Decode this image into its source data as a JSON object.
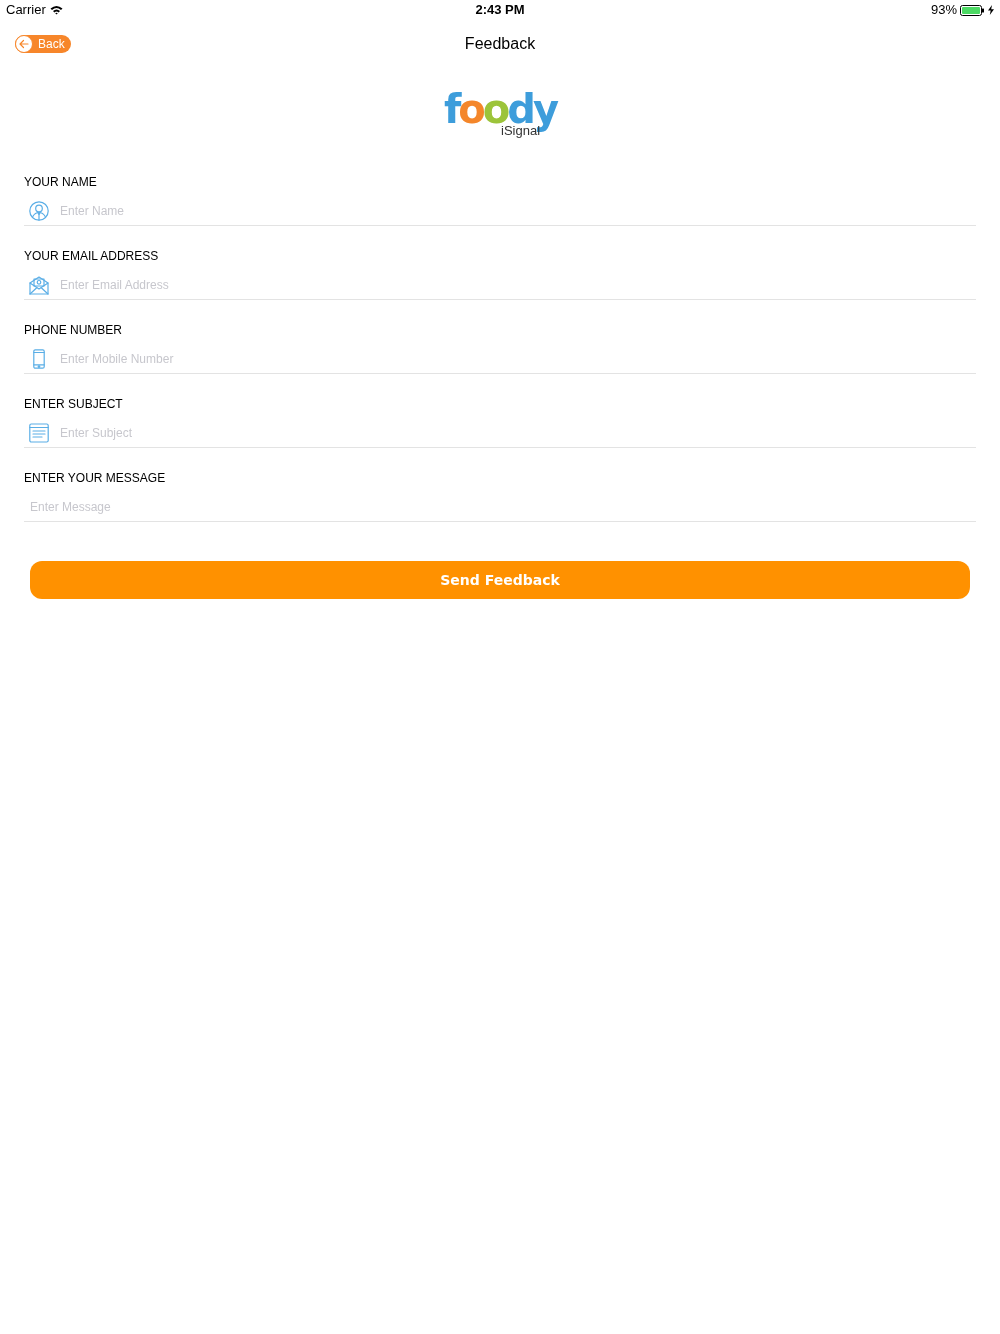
{
  "status_bar": {
    "carrier": "Carrier",
    "time": "2:43 PM",
    "battery": "93%"
  },
  "nav": {
    "back": "Back",
    "title": "Feedback"
  },
  "logo": {
    "word": "foody",
    "tagline": "iSignal"
  },
  "fields": [
    {
      "label": "YOUR NAME",
      "kind": "name",
      "placeholder": "Enter Name"
    },
    {
      "label": "YOUR EMAIL ADDRESS",
      "kind": "email",
      "placeholder": "Enter Email Address"
    },
    {
      "label": "PHONE NUMBER",
      "kind": "phone",
      "placeholder": "Enter Mobile Number"
    },
    {
      "label": "ENTER SUBJECT",
      "kind": "subject",
      "placeholder": "Enter Subject"
    },
    {
      "label": "ENTER YOUR MESSAGE",
      "kind": "message",
      "placeholder": "Enter Message"
    }
  ],
  "submit": "Send Feedback"
}
